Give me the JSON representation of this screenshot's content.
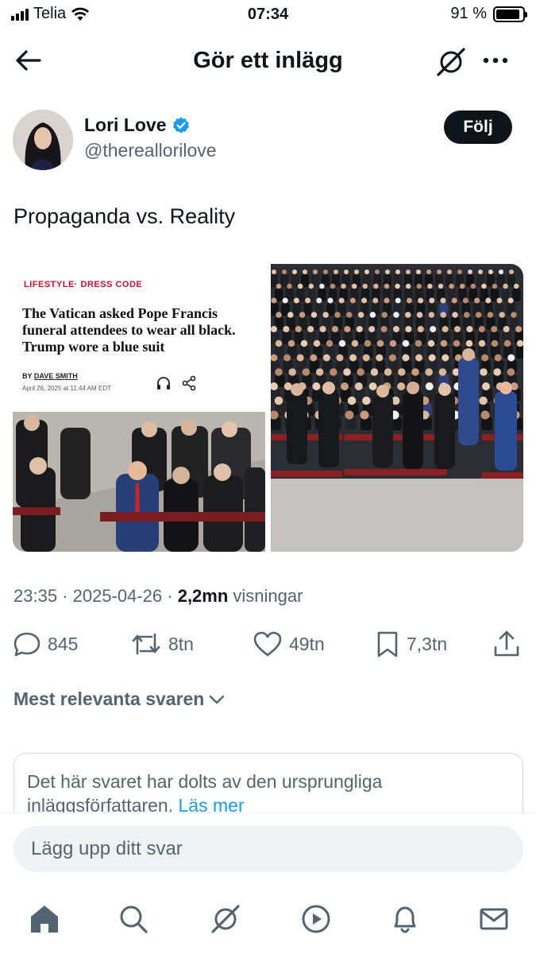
{
  "status_bar": {
    "carrier": "Telia",
    "time": "07:34",
    "battery": "91 %",
    "battery_level": 0.91
  },
  "header": {
    "title": "Gör ett inlägg",
    "back_icon": "arrow-left-icon",
    "grok_icon": "grok-icon",
    "more_icon": "more-horizontal-icon"
  },
  "author": {
    "name": "Lori Love",
    "handle": "@thereallorilove",
    "verified": true,
    "follow_label": "Följ"
  },
  "post": {
    "text": "Propaganda vs. Reality",
    "article": {
      "category": "LIFESTYLE· DRESS CODE",
      "headline": "The Vatican asked Pope Francis funeral attendees to wear all black. Trump wore a blue suit",
      "by_prefix": "BY",
      "byline": "DAVE SMITH",
      "date": "April 26, 2025 at 11:44 AM EDT"
    },
    "timestamp": "23:35 · 2025-04-26 · ",
    "views_count": "2,2mn",
    "views_label": " visningar"
  },
  "actions": {
    "replies": "845",
    "reposts": "8tn",
    "likes": "49tn",
    "bookmarks": "7,3tn"
  },
  "replies": {
    "sort_label": "Mest relevanta svaren",
    "hidden_text": "Det här svaret har dolts av den ursprungliga inläggsförfattaren. ",
    "hidden_link": "Läs mer"
  },
  "reply_box": {
    "placeholder": "Lägg upp ditt svar"
  },
  "tabbar": {
    "items": [
      "home-icon",
      "search-icon",
      "grok-icon",
      "video-icon",
      "bell-icon",
      "mail-icon"
    ]
  },
  "colors": {
    "accent": "#1d9bf0",
    "text": "#0f1419",
    "muted": "#536471",
    "article_red": "#c8102e"
  }
}
